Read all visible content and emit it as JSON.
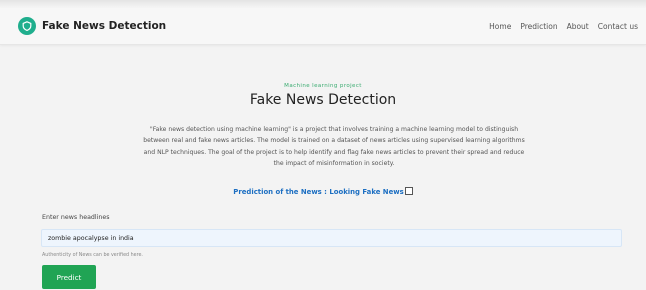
{
  "navbar": {
    "brand": "Fake News Detection",
    "logo_icon": "shield-icon",
    "links": [
      "Home",
      "Prediction",
      "About",
      "Contact us"
    ]
  },
  "hero": {
    "eyebrow": "Machine learning project",
    "title": "Fake News Detection",
    "description": "\"Fake news detection using machine learning\" is a project that involves training a machine learning model to distinguish between real and fake news articles. The model is trained on a dataset of news articles using supervised learning algorithms and NLP techniques. The goal of the project is to help identify and flag fake news articles to prevent their spread and reduce the impact of misinformation in society.",
    "prediction_text": "Prediction of the News : Looking Fake News"
  },
  "form": {
    "label": "Enter news headlines",
    "input_value": "zombie apocalypse in india",
    "help_text": "Authenticity of News can be verified here.",
    "submit_label": "Predict"
  },
  "colors": {
    "brand_green": "#1fae8d",
    "eyebrow_green": "#3aab70",
    "prediction_blue": "#1d6fc2",
    "button_green": "#20a454"
  }
}
